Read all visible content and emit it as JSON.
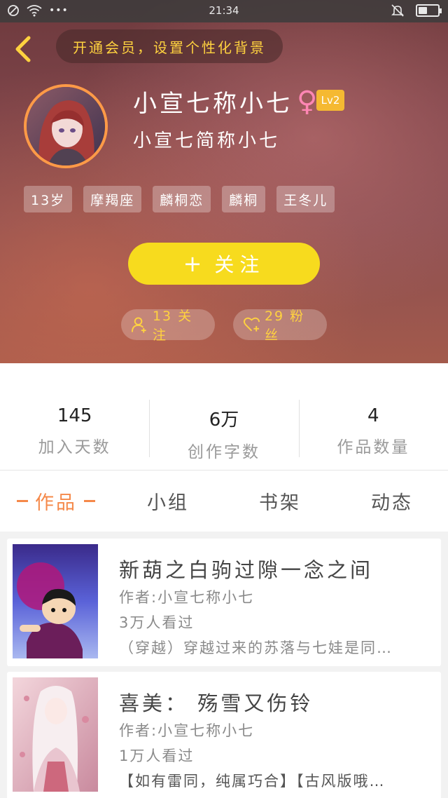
{
  "status_bar": {
    "time": "21:34",
    "dots": "•••",
    "battery_level": 0.45
  },
  "header": {
    "vip_banner": "开通会员，设置个性化背景",
    "username": "小宣七称小七",
    "gender_symbol": "♀",
    "level": "Lv2",
    "signature": "小宣七简称小七",
    "tags": [
      "13岁",
      "摩羯座",
      "麟桐恋",
      "麟桐",
      "王冬儿"
    ],
    "follow_button": "关注",
    "follow_plus": "+",
    "following": "13 关注",
    "fans": "29 粉丝"
  },
  "stats": [
    {
      "value": "145",
      "label": "加入天数"
    },
    {
      "value": "6万",
      "label": "创作字数"
    },
    {
      "value": "4",
      "label": "作品数量"
    }
  ],
  "tabs": [
    {
      "label": "作品",
      "active": true
    },
    {
      "label": "小组",
      "active": false
    },
    {
      "label": "书架",
      "active": false
    },
    {
      "label": "动态",
      "active": false
    }
  ],
  "works": [
    {
      "title": "新葫之白驹过隙一念之间",
      "author": "作者:小宣七称小七",
      "views": "3万人看过",
      "desc": "（穿越）穿越过来的苏落与七娃是同…"
    },
    {
      "title": "喜美： 殇雪又伤铃",
      "author": "作者:小宣七称小七",
      "views": "1万人看过",
      "desc": "【如有雷同，纯属巧合】【古风版哦…"
    }
  ],
  "colors": {
    "accent_yellow": "#f7db1e",
    "accent_orange": "#f5894a",
    "vip_text": "#ffd23f",
    "level_badge": "#f5b932"
  }
}
